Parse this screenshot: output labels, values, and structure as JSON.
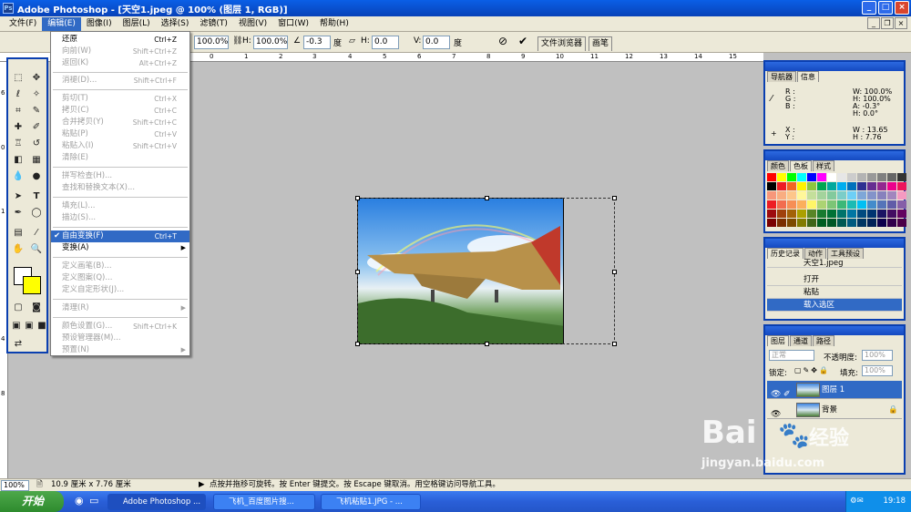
{
  "app": {
    "title": "Adobe Photoshop - [天空1.jpeg @ 100% (图层 1, RGB)]",
    "icon": "photoshop-icon"
  },
  "menu": [
    "文件(F)",
    "编辑(E)",
    "图像(I)",
    "图层(L)",
    "选择(S)",
    "滤镜(T)",
    "视图(V)",
    "窗口(W)",
    "帮助(H)"
  ],
  "options": {
    "w_value": "100.0%",
    "h_label": "H:",
    "h_value": "100.0%",
    "angle_value": "-0.3",
    "angle_unit": "度",
    "skew_h_label": "H:",
    "skew_h_value": "0.0",
    "skew_v_label": "V:",
    "skew_v_value": "0.0",
    "skew_unit": "度",
    "tabs": [
      "文件浏览器",
      "画笔"
    ]
  },
  "edit_menu": {
    "items": [
      {
        "label": "还原",
        "shortcut": "Ctrl+Z",
        "enabled": true
      },
      {
        "label": "向前(W)",
        "shortcut": "Shift+Ctrl+Z",
        "enabled": false
      },
      {
        "label": "返回(K)",
        "shortcut": "Alt+Ctrl+Z",
        "enabled": false
      },
      {
        "label": "消褪(D)...",
        "shortcut": "Shift+Ctrl+F",
        "enabled": false
      },
      {
        "label": "剪切(T)",
        "shortcut": "Ctrl+X",
        "enabled": false
      },
      {
        "label": "拷贝(C)",
        "shortcut": "Ctrl+C",
        "enabled": false
      },
      {
        "label": "合并拷贝(Y)",
        "shortcut": "Shift+Ctrl+C",
        "enabled": false
      },
      {
        "label": "粘贴(P)",
        "shortcut": "Ctrl+V",
        "enabled": false
      },
      {
        "label": "粘贴入(I)",
        "shortcut": "Shift+Ctrl+V",
        "enabled": false
      },
      {
        "label": "清除(E)",
        "shortcut": "",
        "enabled": false
      },
      {
        "label": "拼写检查(H)...",
        "shortcut": "",
        "enabled": false
      },
      {
        "label": "查找和替换文本(X)...",
        "shortcut": "",
        "enabled": false
      },
      {
        "label": "填充(L)...",
        "shortcut": "",
        "enabled": false
      },
      {
        "label": "描边(S)...",
        "shortcut": "",
        "enabled": false
      },
      {
        "label": "自由变换(F)",
        "shortcut": "Ctrl+T",
        "enabled": true
      },
      {
        "label": "变换(A)",
        "shortcut": "",
        "enabled": true
      },
      {
        "label": "定义画笔(B)...",
        "shortcut": "",
        "enabled": false
      },
      {
        "label": "定义图案(Q)...",
        "shortcut": "",
        "enabled": false
      },
      {
        "label": "定义自定形状(J)...",
        "shortcut": "",
        "enabled": false
      },
      {
        "label": "清理(R)",
        "shortcut": "",
        "enabled": false
      },
      {
        "label": "颜色设置(G)...",
        "shortcut": "Shift+Ctrl+K",
        "enabled": false
      },
      {
        "label": "预设管理器(M)...",
        "shortcut": "",
        "enabled": false
      },
      {
        "label": "预置(N)",
        "shortcut": "",
        "enabled": false
      }
    ]
  },
  "info_panel": {
    "tabs": [
      "导航器",
      "信息"
    ],
    "r": "R :",
    "g": "G :",
    "b": "B :",
    "w_pct": "W: 100.0%",
    "h_pct": "H: 100.0%",
    "a": "A: -0.3°",
    "h_deg": "H: 0.0°",
    "x": "X :",
    "y": "Y :",
    "w_size": "W : 13.65",
    "h_size": "H : 7.76"
  },
  "color_panel": {
    "tabs": [
      "颜色",
      "色板",
      "样式"
    ]
  },
  "history_panel": {
    "tabs": [
      "历史记录",
      "动作",
      "工具预设"
    ],
    "rows": [
      "天空1.jpeg",
      "打开",
      "粘贴",
      "载入选区"
    ]
  },
  "layers_panel": {
    "tabs": [
      "图层",
      "通道",
      "路径"
    ],
    "blend_mode": "正常",
    "opacity_label": "不透明度:",
    "opacity_value": "100%",
    "lock_label": "锁定:",
    "fill_label": "填充:",
    "fill_value": "100%",
    "layers": [
      "图层 1",
      "背景"
    ]
  },
  "status": {
    "zoom": "100%",
    "doc_size": "10.9 厘米 x 7.76 厘米",
    "hint": "点按并拖移可旋转。按 Enter 键提交。按 Escape 键取消。用空格键访问导航工具。"
  },
  "taskbar": {
    "start": "开始",
    "tasks": [
      "Adobe Photoshop ...",
      "飞机_百度图片搜...",
      "飞机粘贴1.JPG - ..."
    ],
    "clock": "19:18"
  },
  "watermark": {
    "brand": "Bai",
    "brand2": "经验",
    "url": "jingyan.baidu.com"
  }
}
